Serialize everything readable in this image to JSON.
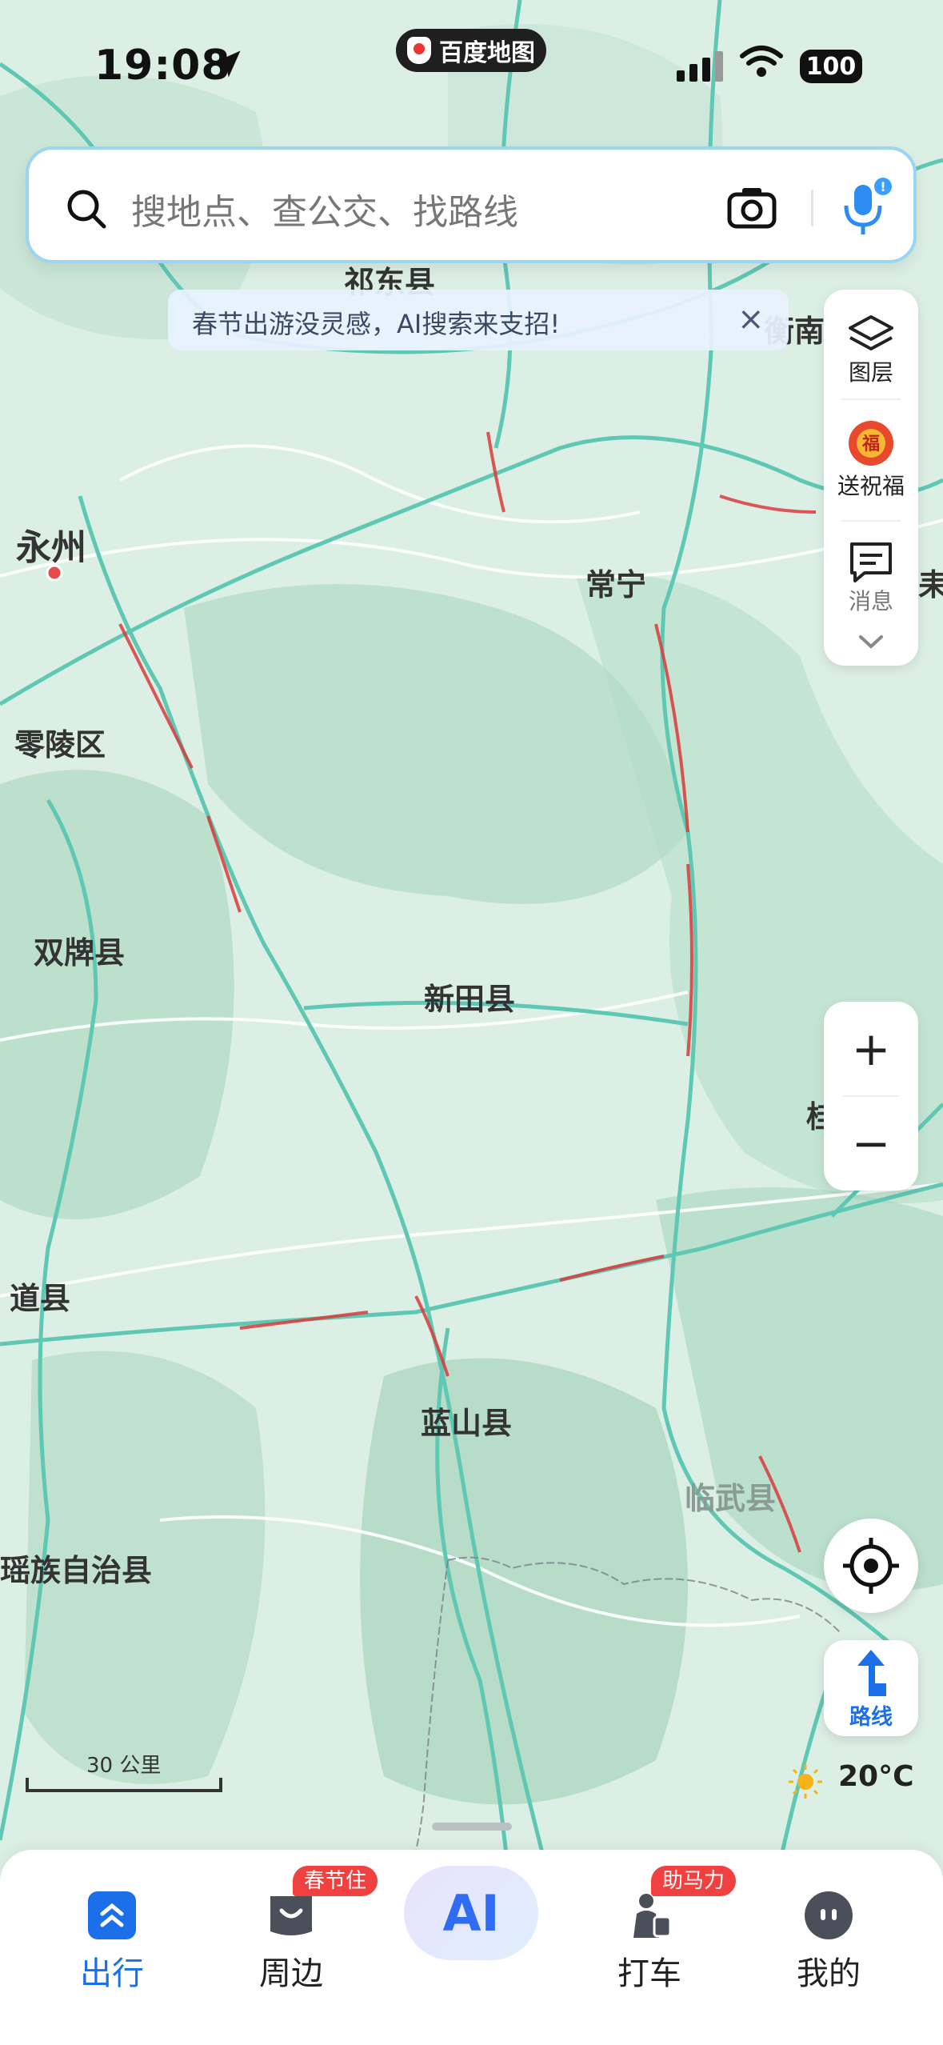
{
  "status_bar": {
    "time": "19:08",
    "app_pill": "百度地图",
    "battery": "100"
  },
  "search": {
    "placeholder": "搜地点、查公交、找路线"
  },
  "banner": {
    "text": "春节出游没灵感，AI搜索来支招!",
    "close": "×"
  },
  "right_panel": {
    "layers": "图层",
    "blessing": "送祝福",
    "messages": "消息"
  },
  "zoom": {
    "in": "+",
    "out": "−"
  },
  "route_button": {
    "label": "路线"
  },
  "weather": {
    "temp": "20°C"
  },
  "scale": {
    "label": "30 公里"
  },
  "map_labels": {
    "qidong": "祁东县",
    "hengnan": "衡南",
    "yongzhou": "永州",
    "changning": "常宁",
    "lingling": "零陵区",
    "shuangpai": "双牌县",
    "xintian": "新田县",
    "daoxian": "道县",
    "lanshan": "蓝山县",
    "linwu": "临武县",
    "yaozu": "瑶族自治县",
    "gui": "桂",
    "lei": "耒"
  },
  "tabs": [
    {
      "label": "出行",
      "active": true
    },
    {
      "label": "周边",
      "badge": "春节住"
    },
    {
      "label": "AI"
    },
    {
      "label": "打车",
      "badge": "助马力"
    },
    {
      "label": "我的"
    }
  ],
  "colors": {
    "accent": "#1b6fe8",
    "badge": "#f04040",
    "road": "#5fc8b4",
    "congestion": "#d93a3a"
  }
}
